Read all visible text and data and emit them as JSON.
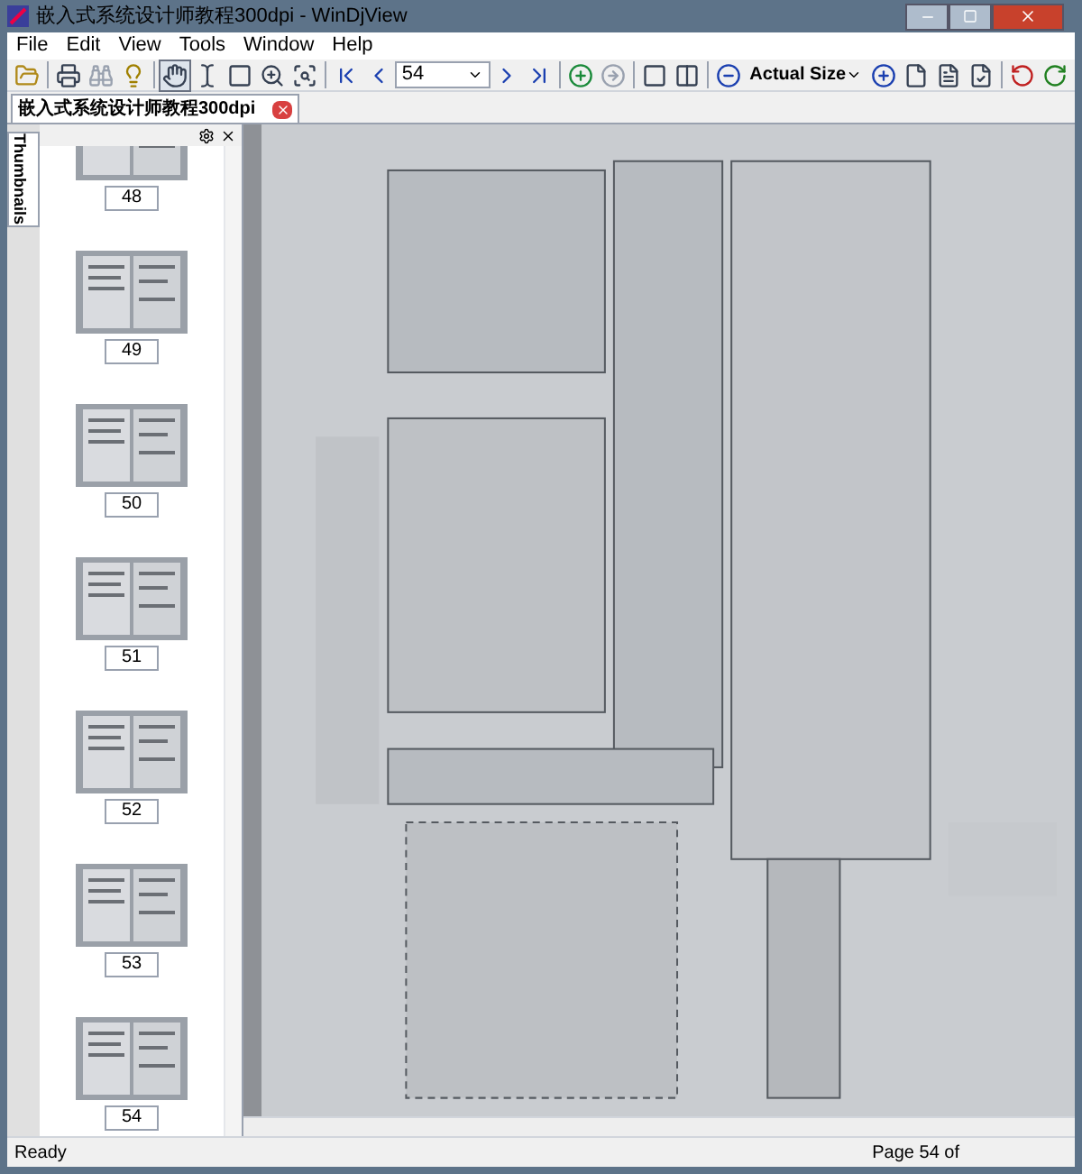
{
  "window": {
    "title": "嵌入式系统设计师教程300dpi - WinDjView"
  },
  "menu": [
    "File",
    "Edit",
    "View",
    "Tools",
    "Window",
    "Help"
  ],
  "toolbar": {
    "page": "54",
    "zoom": "Actual Size",
    "tools": [
      {
        "kind": "hand",
        "selected": true
      },
      {
        "kind": "text",
        "selected": false
      },
      {
        "kind": "area",
        "selected": false
      },
      {
        "kind": "zoom",
        "selected": false
      },
      {
        "kind": "zoomrect",
        "selected": false
      }
    ]
  },
  "document_tab": {
    "label": "嵌入式系统设计师教程300dpi"
  },
  "sidebar": {
    "tab": "Thumbnails",
    "thumbnails": [
      {
        "label": "48"
      },
      {
        "label": "49"
      },
      {
        "label": "50"
      },
      {
        "label": "51"
      },
      {
        "label": "52"
      },
      {
        "label": "53"
      },
      {
        "label": "54"
      }
    ]
  },
  "status_bar": {
    "left": "Ready",
    "page": "Page 54 of"
  }
}
